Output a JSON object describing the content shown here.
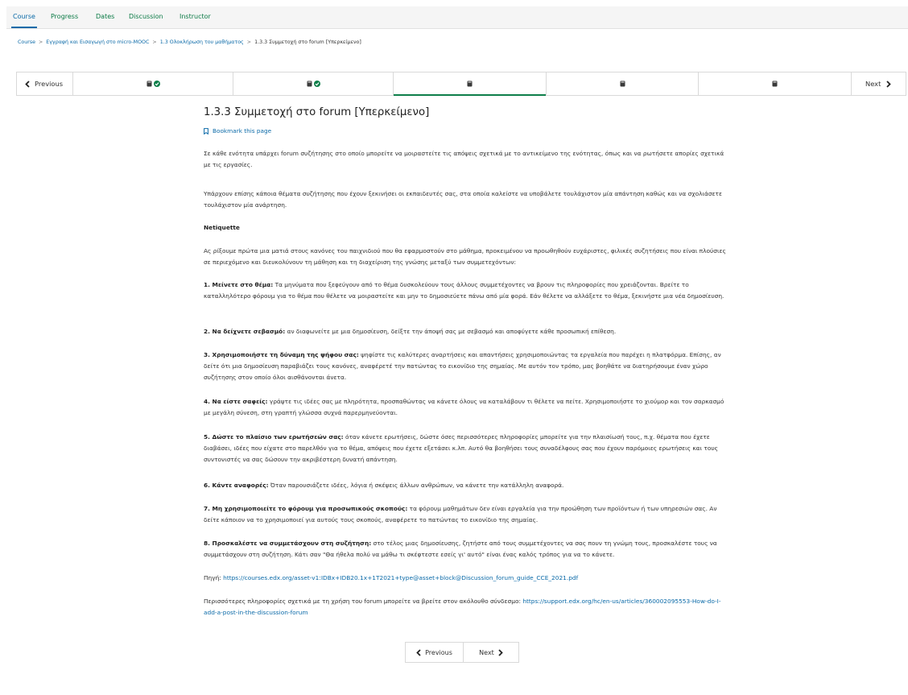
{
  "nav": {
    "tabs": [
      {
        "label": "Course"
      },
      {
        "label": "Progress"
      },
      {
        "label": "Dates"
      },
      {
        "label": "Discussion"
      },
      {
        "label": "Instructor"
      }
    ]
  },
  "breadcrumb": {
    "items": [
      {
        "label": "Course"
      },
      {
        "label": "Εγγραφή και Εισαγωγή στο micro-MOOC"
      },
      {
        "label": "1.3 Ολοκλήρωση του μαθήματος"
      },
      {
        "label": "1.3.3 Συμμετοχή στο forum [Υπερκείμενο]"
      }
    ],
    "separator": ">"
  },
  "sequence": {
    "previous_label": "Previous",
    "next_label": "Next",
    "units": [
      {
        "icon": "book-icon",
        "complete": true
      },
      {
        "icon": "book-icon",
        "complete": true
      },
      {
        "icon": "book-icon",
        "complete": false
      },
      {
        "icon": "book-icon",
        "complete": false
      },
      {
        "icon": "book-icon",
        "complete": false
      }
    ]
  },
  "page": {
    "title": "1.3.3 Συμμετοχή στο forum [Υπερκείμενο]",
    "bookmark": "Bookmark this page",
    "intro1": "Σε κάθε ενότητα υπάρχει forum συζήτησης στο οποίο μπορείτε να μοιραστείτε τις απόψεις σχετικά με το αντικείμενο της ενότητας, όπως και να ρωτήσετε απορίες σχετικά με τις εργασίες.",
    "intro2": "Υπάρχουν επίσης κάποια θέματα συζήτησης που έχουν ξεκινήσει οι εκπαιδευτές σας, στα οποία καλείστε να υποβάλετε τουλάχιστον μία απάντηση καθώς και να σχολιάσετε τουλάχιστον μία ανάρτηση.",
    "netiquette_heading": "Netiquette",
    "netiquette_intro": "Ας ρίξουμε πρώτα μια ματιά στους κανόνες του παιχνιδιού που θα εφαρμοστούν στο μάθημα, προκειμένου να προωθηθούν ευχάριστες, φιλικές συζητήσεις που είναι πλούσιες σε περιεχόμενο και διευκολύνουν τη μάθηση και τη διαχείριση της γνώσης μεταξύ των συμμετεχόντων:",
    "rules": [
      {
        "bold": "1. Μείνετε στο θέμα:",
        "text": " Τα μηνύματα που ξεφεύγουν από το θέμα δυσκολεύουν τους άλλους συμμετέχοντες να βρουν τις πληροφορίες που χρειάζονται. Βρείτε το καταλληλότερο φόρουμ για το θέμα που θέλετε να μοιραστείτε και μην το δημοσιεύετε πάνω από μία φορά. Εάν θέλετε να αλλάξετε το θέμα, ξεκινήστε μια νέα δημοσίευση."
      },
      {
        "bold": "2. Να δείχνετε σεβασμό:",
        "text": " αν διαφωνείτε με μια δημοσίευση, δείξτε την άποψή σας με σεβασμό και αποφύγετε κάθε προσωπική επίθεση."
      },
      {
        "bold": "3. Χρησιμοποιήστε τη δύναμη της ψήφου σας:",
        "text": " ψηφίστε τις καλύτερες αναρτήσεις και απαντήσεις χρησιμοποιώντας τα εργαλεία που παρέχει η πλατφόρμα. Επίσης, αν δείτε ότι μια δημοσίευση παραβιάζει τους κανόνες, αναφέρετέ την πατώντας το εικονίδιο της σημαίας. Με αυτόν τον τρόπο, μας βοηθάτε να διατηρήσουμε έναν χώρο συζήτησης στον οποίο όλοι αισθάνονται άνετα."
      },
      {
        "bold": "4. Να είστε σαφείς:",
        "text": " γράψτε τις ιδέες σας με πληρότητα, προσπαθώντας να κάνετε όλους να καταλάβουν τι θέλετε να πείτε. Χρησιμοποιήστε το χιούμορ και τον σαρκασμό με μεγάλη σύνεση, στη γραπτή γλώσσα συχνά παρερμηνεύονται."
      },
      {
        "bold": "5. Δώστε το πλαίσιο των ερωτήσεών σας:",
        "text": " όταν κάνετε ερωτήσεις, δώστε όσες περισσότερες πληροφορίες μπορείτε για την πλαισίωσή τους, π.χ. θέματα που έχετε διαβάσει, ιδέες που είχατε στο παρελθόν για το θέμα, απόψεις που έχετε εξετάσει κ.λπ. Αυτό θα βοηθήσει τους συναδέλφους σας που έχουν παρόμοιες ερωτήσεις και τους συντονιστές να σας δώσουν την ακριβέστερη δυνατή απάντηση."
      },
      {
        "bold": "6. Κάντε αναφορές:",
        "text": " Όταν παρουσιάζετε ιδέες, λόγια ή σκέψεις άλλων ανθρώπων, να κάνετε την κατάλληλη αναφορά."
      },
      {
        "bold": "7. Μη χρησιμοποιείτε το φόρουμ για προσωπικούς σκοπούς:",
        "text": " τα φόρουμ μαθημάτων δεν είναι εργαλεία για την προώθηση των προϊόντων ή των υπηρεσιών σας. Αν δείτε κάποιον να το χρησιμοποιεί για αυτούς τους σκοπούς, αναφέρετε το πατώντας το εικονίδιο της σημαίας."
      },
      {
        "bold": "8. Προσκαλέστε να συμμετάσχουν στη συζήτηση:",
        "text": " στο τέλος μιας δημοσίευσης, ζητήστε από τους συμμετέχοντες να σας πουν τη γνώμη τους, προσκαλέστε τους να συμμετάσχουν στη συζήτηση. Κάτι σαν \"Θα ήθελα πολύ να μάθω τι σκέφτεστε εσείς γι' αυτό\" είναι ένας καλός τρόπος για να το κάνετε."
      }
    ],
    "source_label": "Πηγή: ",
    "source_link": "https://courses.edx.org/asset-v1:IDBx+IDB20.1x+1T2021+type@asset+block@Discussion_forum_guide_CCE_2021.pdf",
    "more_label": "Περισσότερες πληροφορίες σχετικά με τη χρήση του forum μπορείτε να βρείτε στον ακόλουθο σύνδεσμο: ",
    "more_link": "https://support.edx.org/hc/en-us/articles/360002095553-How-do-I-add-a-post-in-the-discussion-forum"
  },
  "bottom_nav": {
    "previous_label": "Previous",
    "next_label": "Next"
  },
  "colors": {
    "link": "#0b6aa8",
    "tab": "#0a7a45",
    "complete_check": "#0e7f4a"
  }
}
